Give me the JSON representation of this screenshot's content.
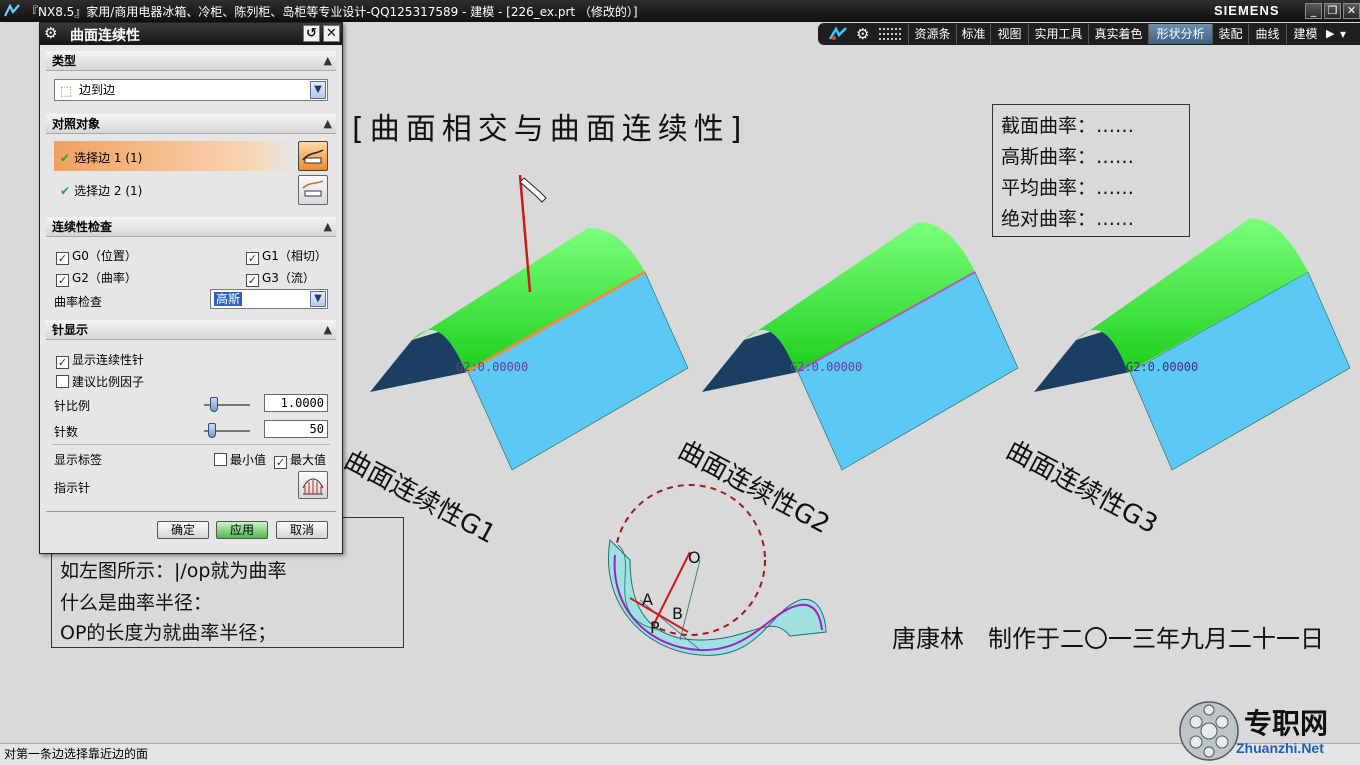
{
  "window": {
    "title": "『NX8.5』家用/商用电器冰箱、冷柜、陈列柜、岛柜等专业设计-QQ125317589 - 建模 - [226_ex.prt （修改的）]",
    "brand": "SIEMENS",
    "controls": [
      "_",
      "❐",
      "✕"
    ]
  },
  "toolbar": {
    "tabs": [
      "资源条",
      "标准",
      "视图",
      "实用工具",
      "真实着色",
      "形状分析",
      "装配",
      "曲线",
      "建模"
    ],
    "active_tab": "形状分析"
  },
  "dialog": {
    "title": "曲面连续性",
    "type_section": {
      "label": "类型",
      "value": "边到边"
    },
    "compare_section": {
      "label": "对照对象",
      "item1": "选择边 1 (1)",
      "item2": "选择边 2 (1)"
    },
    "continuity_section": {
      "label": "连续性检查",
      "g0": "G0（位置）",
      "g1": "G1（相切）",
      "g2": "G2（曲率）",
      "g3": "G3（流）",
      "curvature_label": "曲率检查",
      "curvature_value": "高斯"
    },
    "needle_section": {
      "label": "针显示",
      "show_needle": "显示连续性针",
      "suggest_scale": "建议比例因子",
      "scale_label": "针比例",
      "scale_value": "1.0000",
      "count_label": "针数",
      "count_value": "50",
      "show_label": "显示标签",
      "min_label": "最小值",
      "max_label": "最大值",
      "pointer_label": "指示针"
    },
    "buttons": {
      "ok": "确定",
      "apply": "应用",
      "cancel": "取消"
    }
  },
  "canvas": {
    "heading": "[曲面相交与曲面连续性]",
    "curvature_box": [
      "截面曲率：……",
      "高斯曲率：……",
      "平均曲率：……",
      "绝对曲率：……"
    ],
    "model_tag": "G2:0.00000",
    "model_labels": [
      "曲面连续性G1",
      "曲面连续性G2",
      "曲面连续性G3"
    ],
    "note_lines": [
      "如左图所示：|/op就为曲率",
      "什么是曲率半径：",
      "OP的长度为就曲率半径；"
    ],
    "diagram_labels": {
      "o": "O",
      "a": "A",
      "b": "B",
      "p": "P"
    },
    "signature": "唐康林　制作于二〇一三年九月二十一日"
  },
  "status_text": "对第一条边选择靠近边的面",
  "watermark": {
    "cn": "专职网",
    "en": "Zhuanzhi.Net"
  },
  "colors": {
    "surface_top": "#33e633",
    "surface_side": "#5bc8f5",
    "surface_dark": "#1b3e63",
    "needle": "#d02020",
    "accent_tab": "#4d7096"
  }
}
